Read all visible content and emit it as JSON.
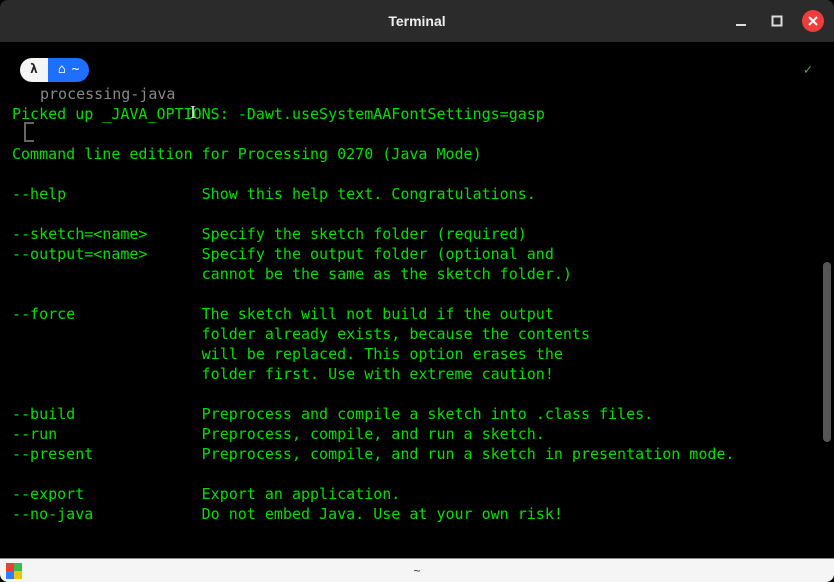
{
  "window": {
    "title": "Terminal"
  },
  "prompt": {
    "lambda": "λ",
    "home": "⌂",
    "tilde": "~",
    "check": "✓"
  },
  "command": "processing-java",
  "output": "Picked up _JAVA_OPTIONS: -Dawt.useSystemAAFontSettings=gasp\n\nCommand line edition for Processing 0270 (Java Mode)\n\n--help               Show this help text. Congratulations.\n\n--sketch=<name>      Specify the sketch folder (required)\n--output=<name>      Specify the output folder (optional and\n                     cannot be the same as the sketch folder.)\n\n--force              The sketch will not build if the output\n                     folder already exists, because the contents\n                     will be replaced. This option erases the\n                     folder first. Use with extreme caution!\n\n--build              Preprocess and compile a sketch into .class files.\n--run                Preprocess, compile, and run a sketch.\n--present            Preprocess, compile, and run a sketch in presentation mode.\n\n--export             Export an application.\n--no-java            Do not embed Java. Use at your own risk!",
  "statusbar": {
    "tilde": "~"
  },
  "cursor_glyph": "I"
}
